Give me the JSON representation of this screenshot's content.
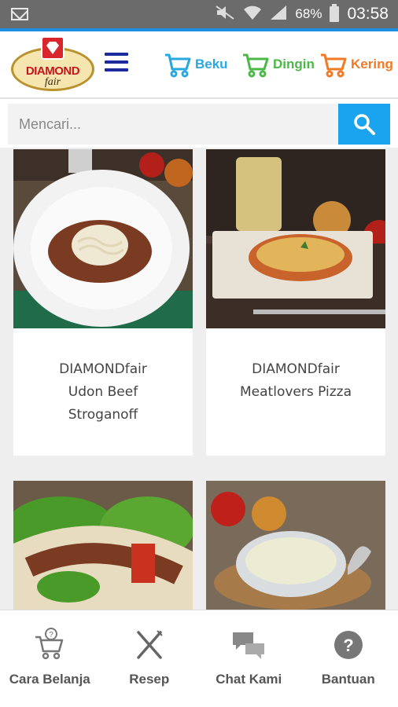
{
  "status": {
    "battery": "68%",
    "time": "03:58"
  },
  "header": {
    "logo_text": "DIAMOND",
    "logo_sub": "fair",
    "categories": [
      {
        "label": "Beku",
        "color": "#29a8e0"
      },
      {
        "label": "Dingin",
        "color": "#4cb848"
      },
      {
        "label": "Kering",
        "color": "#f07a26"
      }
    ]
  },
  "search": {
    "placeholder": "Mencari..."
  },
  "products": [
    {
      "title_line1": "DIAMONDfair",
      "title_line2": "Udon Beef",
      "title_line3": "Stroganoff"
    },
    {
      "title_line1": "DIAMONDfair",
      "title_line2": "Meatlovers Pizza",
      "title_line3": ""
    }
  ],
  "bottom_nav": [
    {
      "label": "Cara Belanja",
      "icon": "cart-question-icon"
    },
    {
      "label": "Resep",
      "icon": "cutlery-icon"
    },
    {
      "label": "Chat Kami",
      "icon": "chat-icon"
    },
    {
      "label": "Bantuan",
      "icon": "help-icon"
    }
  ]
}
